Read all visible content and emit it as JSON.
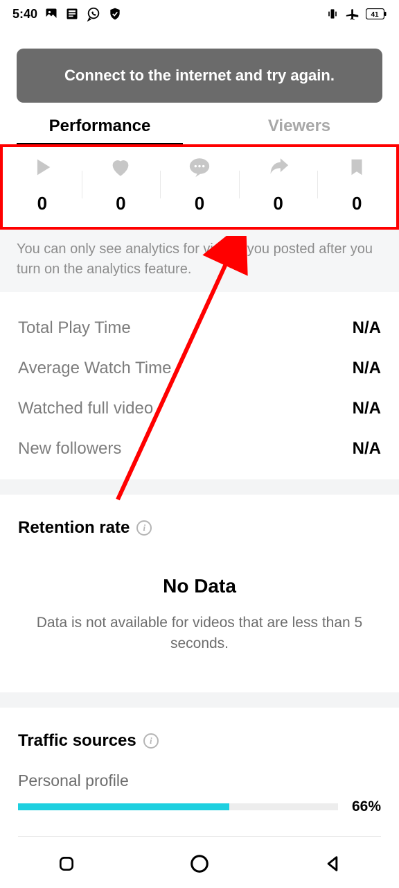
{
  "statusbar": {
    "time": "5:40",
    "battery": "41"
  },
  "banner": {
    "text": "Connect to the internet and try again."
  },
  "tabs": {
    "performance": "Performance",
    "viewers": "Viewers"
  },
  "stats": {
    "plays": "0",
    "likes": "0",
    "comments": "0",
    "shares": "0",
    "saves": "0"
  },
  "notice": "You can only see analytics for videos you posted after you turn on the analytics feature.",
  "metrics": {
    "total_play_time": {
      "label": "Total Play Time",
      "value": "N/A"
    },
    "avg_watch_time": {
      "label": "Average Watch Time",
      "value": "N/A"
    },
    "watched_full": {
      "label": "Watched full video",
      "value": "N/A"
    },
    "new_followers": {
      "label": "New followers",
      "value": "N/A"
    }
  },
  "retention": {
    "title": "Retention rate",
    "no_data_title": "No Data",
    "no_data_text": "Data is not available for videos that are less than 5 seconds."
  },
  "traffic": {
    "title": "Traffic sources",
    "items": [
      {
        "label": "Personal profile",
        "pct_text": "66%",
        "pct_num": 66
      }
    ]
  }
}
